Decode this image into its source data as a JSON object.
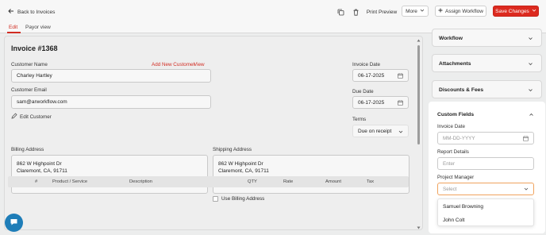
{
  "header": {
    "back_label": "Back to Invoices",
    "print_preview": "Print Preview",
    "more": "More",
    "assign_workflow": "Assign Workflow",
    "save_changes": "Save Changes"
  },
  "tabs": [
    {
      "label": "Edit",
      "active": true
    },
    {
      "label": "Payor view",
      "active": false
    }
  ],
  "invoice": {
    "title": "Invoice #1368",
    "customer_name_label": "Customer Name",
    "add_new_customer": "Add New Customer",
    "view": "View",
    "customer_name": "Charley Hartley",
    "customer_email_label": "Customer Email",
    "customer_email": "sam@arworkflow.com",
    "edit_customer": "Edit Customer",
    "invoice_date_label": "Invoice Date",
    "invoice_date": "06-17-2025",
    "due_date_label": "Due Date",
    "due_date": "06-17-2025",
    "terms_label": "Terms",
    "terms": "Due on receipt",
    "billing_label": "Billing Address",
    "billing_line1": "862 W Highpoint Dr",
    "billing_line2": "Claremont, CA, 91711",
    "shipping_label": "Shipping Address",
    "shipping_line1": "862 W Highpoint Dr",
    "shipping_line2": "Claremont, CA, 91711",
    "use_billing": "Use Billing Address",
    "columns": [
      "#",
      "Product / Service",
      "Description",
      "QTY",
      "Rate",
      "Amount",
      "Tax"
    ]
  },
  "sidebar": {
    "workflow": "Workflow",
    "attachments": "Attachments",
    "discounts": "Discounts & Fees",
    "custom_fields": "Custom Fields",
    "cf_invoice_date_label": "Invoice Date",
    "cf_invoice_date_placeholder": "MM-DD-YYYY",
    "report_details_label": "Report Details",
    "report_details_placeholder": "Enter",
    "project_manager_label": "Project Manager",
    "project_manager_placeholder": "Select",
    "options": [
      "Samuel Browning",
      "John Colt"
    ]
  },
  "colors": {
    "accent": "#d12c22",
    "focus": "#f0a35e",
    "chat": "#1e7db8"
  },
  "icons": [
    "arrow-left-icon",
    "copy-icon",
    "trash-icon",
    "chevron-down-icon",
    "plus-icon",
    "calendar-icon",
    "pencil-icon",
    "chevron-up-icon",
    "chat-icon"
  ]
}
